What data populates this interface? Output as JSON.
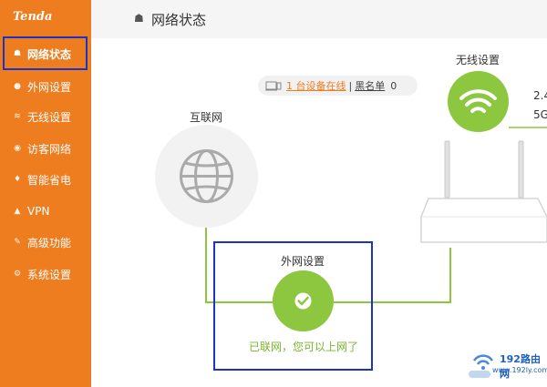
{
  "app": {
    "logo": "Tenda"
  },
  "sidebar": {
    "items": [
      {
        "label": "网络状态",
        "active": true
      },
      {
        "label": "外网设置"
      },
      {
        "label": "无线设置"
      },
      {
        "label": "访客网络"
      },
      {
        "label": "智能省电"
      },
      {
        "label": "VPN"
      },
      {
        "label": "高级功能"
      },
      {
        "label": "系统设置"
      }
    ]
  },
  "header": {
    "title": "网络状态"
  },
  "devices": {
    "online_link": "1 台设备在线",
    "separator": "|",
    "blacklist_label": "黑名单",
    "blacklist_count": "0"
  },
  "diagram": {
    "internet_label": "互联网",
    "wireless_label": "无线设置",
    "band_24": "2.4",
    "band_5": "5G",
    "wan_label": "外网设置",
    "wan_status": "已联网，您可以上网了"
  },
  "watermark": {
    "text": "192路由网",
    "url": "www.192ly.com"
  },
  "colors": {
    "accent": "#ee7d20",
    "success": "#8dc63f",
    "highlight": "#1d33c4"
  }
}
